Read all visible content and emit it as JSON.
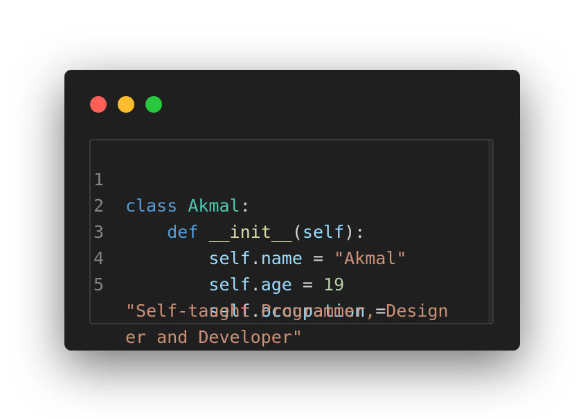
{
  "window": {
    "controls": [
      {
        "name": "close",
        "color": "#ff5f56"
      },
      {
        "name": "minimize",
        "color": "#ffbd2e"
      },
      {
        "name": "maximize",
        "color": "#27c93f"
      }
    ]
  },
  "code": {
    "line_numbers": [
      "1",
      "2",
      "3",
      "4",
      "5"
    ],
    "line1": {
      "kw": "class",
      "space": " ",
      "name": "Akmal",
      "punct": ":"
    },
    "line2": {
      "indent": "    ",
      "kw": "def",
      "space": " ",
      "fn": "__init__",
      "open": "(",
      "param": "self",
      "close": "):"
    },
    "line3": {
      "indent": "        ",
      "obj": "self",
      "dot": ".",
      "attr": "name",
      "op": " = ",
      "value": "\"Akmal\""
    },
    "line4": {
      "indent": "        ",
      "obj": "self",
      "dot": ".",
      "attr": "age",
      "op": " = ",
      "value": "19"
    },
    "line5": {
      "indent": "        ",
      "obj": "self",
      "dot": ".",
      "attr": "occupation",
      "op": " ="
    },
    "line5_wrap1": "\"Self-taught Programmer, Design",
    "line5_wrap2": "er and Developer\""
  }
}
